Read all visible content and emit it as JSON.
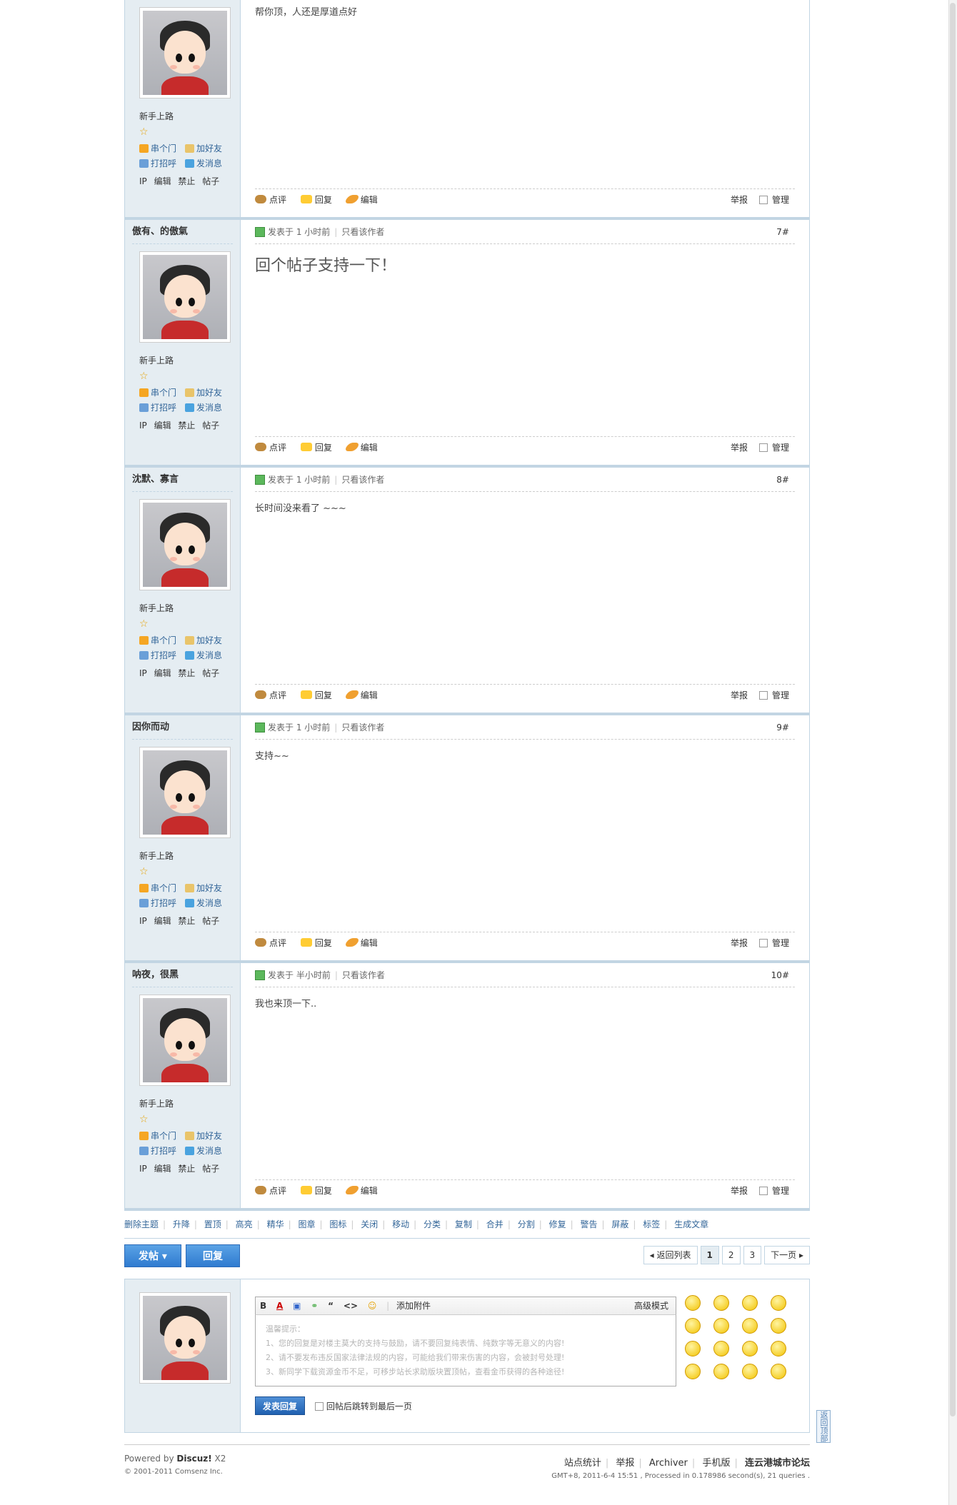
{
  "posts": [
    {
      "author": "",
      "rank": "新手上路",
      "links": [
        "串个门",
        "加好友",
        "打招呼",
        "发消息"
      ],
      "admin": "IP 编辑 禁止 帖子",
      "time": "",
      "only_author": "",
      "floor": "",
      "content": "帮你顶，人还是厚道点好",
      "big": false
    },
    {
      "author": "傲有、的傲氣",
      "rank": "新手上路",
      "links": [
        "串个门",
        "加好友",
        "打招呼",
        "发消息"
      ],
      "admin": "IP 编辑 禁止 帖子",
      "time": "发表于 1 小时前",
      "only_author": "只看该作者",
      "floor": "7#",
      "content": "回个帖子支持一下！",
      "big": true
    },
    {
      "author": "沈默、寡言",
      "rank": "新手上路",
      "links": [
        "串个门",
        "加好友",
        "打招呼",
        "发消息"
      ],
      "admin": "IP 编辑 禁止 帖子",
      "time": "发表于 1 小时前",
      "only_author": "只看该作者",
      "floor": "8#",
      "content": "长时间没来看了 ~~~",
      "big": false
    },
    {
      "author": "因你而动",
      "rank": "新手上路",
      "links": [
        "串个门",
        "加好友",
        "打招呼",
        "发消息"
      ],
      "admin": "IP 编辑 禁止 帖子",
      "time": "发表于 1 小时前",
      "only_author": "只看该作者",
      "floor": "9#",
      "content": "支持~~",
      "big": false
    },
    {
      "author": "呐夜，很黑",
      "rank": "新手上路",
      "links": [
        "串个门",
        "加好友",
        "打招呼",
        "发消息"
      ],
      "admin": "IP 编辑 禁止 帖子",
      "time": "发表于 半小时前",
      "only_author": "只看该作者",
      "floor": "10#",
      "content": "我也来顶一下..",
      "big": false
    }
  ],
  "post_actions": {
    "comment": "点评",
    "reply": "回复",
    "edit": "编辑",
    "report": "举报",
    "manage": "管理"
  },
  "mod_bar": [
    "删除主题",
    "升降",
    "置顶",
    "高亮",
    "精华",
    "图章",
    "图标",
    "关闭",
    "移动",
    "分类",
    "复制",
    "合并",
    "分割",
    "修复",
    "警告",
    "屏蔽",
    "标签",
    "生成文章"
  ],
  "buttons": {
    "new_post": "发帖 ▾",
    "reply": "回复"
  },
  "pager": {
    "back": "◂ 返回列表",
    "pages": [
      "1",
      "2",
      "3"
    ],
    "current": "1",
    "next": "下一页 ▸"
  },
  "editor": {
    "toolbar": [
      "B",
      "A",
      "▣",
      "⚭",
      "“",
      "<>",
      "☺"
    ],
    "attach": "添加附件",
    "advanced": "高级模式",
    "tips_title": "温馨提示：",
    "tips": [
      "1、您的回复是对楼主莫大的支持与鼓励，请不要回复纯表情、纯数字等无意义的内容!",
      "2、请不要发布违反国家法律法规的内容，可能给我们带来伤害的内容，会被封号处理!",
      "3、新同学下载资源金币不足，可移步站长求助版块置顶帖，查看金币获得的各种途径!"
    ],
    "submit": "发表回复",
    "jump_last": "回帖后跳转到最后一页"
  },
  "footer": {
    "powered_prefix": "Powered by ",
    "powered_brand": "Discuz!",
    "powered_version": " X2",
    "copyright": "© 2001-2011 Comsenz Inc.",
    "links": [
      "站点统计",
      "举报",
      "Archiver",
      "手机版"
    ],
    "site_name": "连云港城市论坛",
    "gmt": "GMT+8, 2011-6-4 15:51 , Processed in 0.178986 second(s), 21 queries ."
  },
  "back_to_top": "返回顶部"
}
